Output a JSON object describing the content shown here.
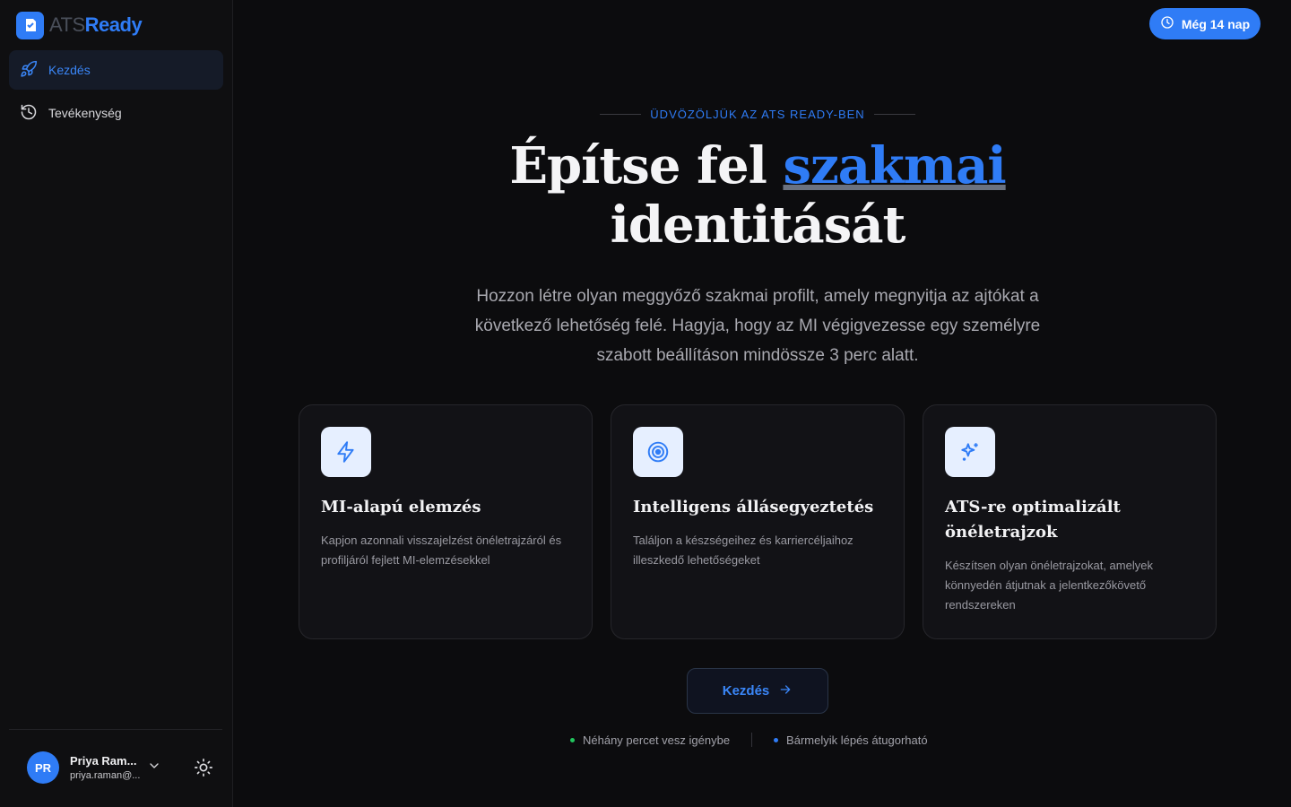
{
  "brand": {
    "name_part1": "ATS",
    "name_part2": "Ready"
  },
  "sidebar": {
    "items": [
      {
        "label": "Kezdés",
        "icon": "rocket-icon",
        "active": true
      },
      {
        "label": "Tevékenység",
        "icon": "history-icon",
        "active": false
      }
    ],
    "user": {
      "initials": "PR",
      "name": "Priya Ram...",
      "email": "priya.raman@..."
    }
  },
  "trial": {
    "label": "Még 14 nap",
    "icon": "clock-icon"
  },
  "hero": {
    "eyebrow": "ÜDVÖZÖLJÜK AZ ATS READY-BEN",
    "title_part1": "Építse fel ",
    "title_accent": "szakmai",
    "title_part2": "identitását",
    "subtitle": "Hozzon létre olyan meggyőző szakmai profilt, amely megnyitja az ajtókat a következő lehetőség felé. Hagyja, hogy az MI végigvezesse egy személyre szabott beállításon mindössze 3 perc alatt."
  },
  "cards": [
    {
      "icon": "lightning-icon",
      "title": "MI-alapú elemzés",
      "description": "Kapjon azonnali visszajelzést önéletrajzáról és profiljáról fejlett MI-elemzésekkel"
    },
    {
      "icon": "target-icon",
      "title": "Intelligens állásegyeztetés",
      "description": "Találjon a készségeihez és karriercéljaihoz illeszkedő lehetőségeket"
    },
    {
      "icon": "sparkles-icon",
      "title": "ATS-re optimalizált önéletrajzok",
      "description": "Készítsen olyan önéletrajzokat, amelyek könnyedén átjutnak a jelentkezőkövető rendszereken"
    }
  ],
  "cta": {
    "label": "Kezdés"
  },
  "notes": [
    {
      "text": "Néhány percet vesz igénybe",
      "color": "#22c55e"
    },
    {
      "text": "Bármelyik lépés átugorható",
      "color": "#2f7cf6"
    }
  ],
  "colors": {
    "accent": "#2f7cf6",
    "background": "#0c0c0e",
    "card": "#121216"
  }
}
